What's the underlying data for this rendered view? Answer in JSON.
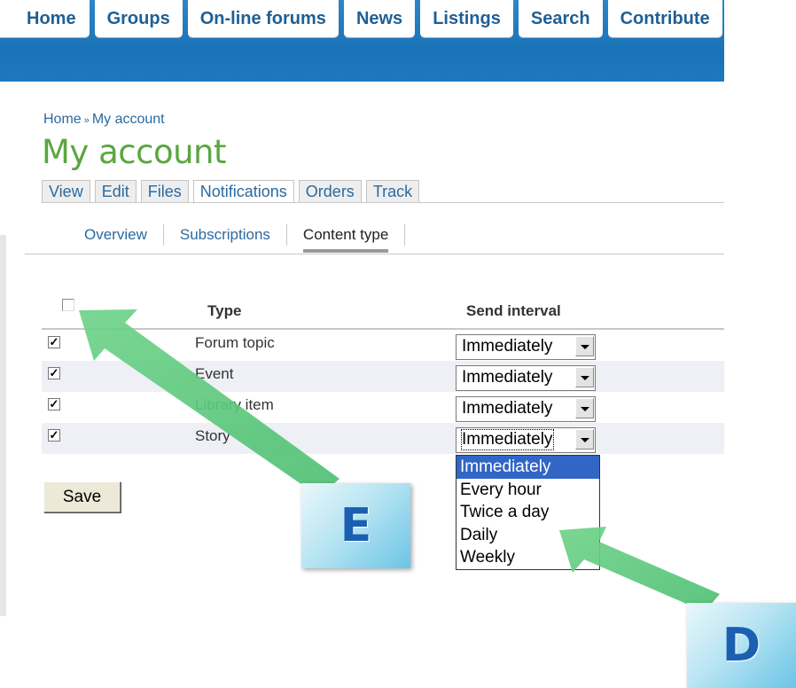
{
  "nav": {
    "items": [
      "Home",
      "Groups",
      "On-line forums",
      "News",
      "Listings",
      "Search",
      "Contribute"
    ]
  },
  "breadcrumb": {
    "home": "Home",
    "sep": "»",
    "current": "My account"
  },
  "page_title": "My account",
  "account_tabs": [
    "View",
    "Edit",
    "Files",
    "Notifications",
    "Orders",
    "Track"
  ],
  "account_tabs_active": "Notifications",
  "sub_tabs": [
    "Overview",
    "Subscriptions",
    "Content type"
  ],
  "sub_tabs_active": "Content type",
  "table": {
    "headers": {
      "type": "Type",
      "interval": "Send interval"
    },
    "rows": [
      {
        "checked": true,
        "type": "Forum topic",
        "interval": "Immediately"
      },
      {
        "checked": true,
        "type": "Event",
        "interval": "Immediately"
      },
      {
        "checked": true,
        "type": "Library item",
        "interval": "Immediately"
      },
      {
        "checked": true,
        "type": "Story",
        "interval": "Immediately"
      }
    ]
  },
  "dropdown": {
    "options": [
      "Immediately",
      "Every hour",
      "Twice a day",
      "Daily",
      "Weekly"
    ],
    "selected": "Immediately"
  },
  "save_label": "Save",
  "annotations": {
    "badge_e": "E",
    "badge_d": "D",
    "arrow_color": "#5cc87a"
  },
  "colors": {
    "nav_blue": "#1a73b8",
    "title_green": "#5aa641",
    "link_blue": "#2b6aa0",
    "selection_blue": "#3166c6"
  }
}
